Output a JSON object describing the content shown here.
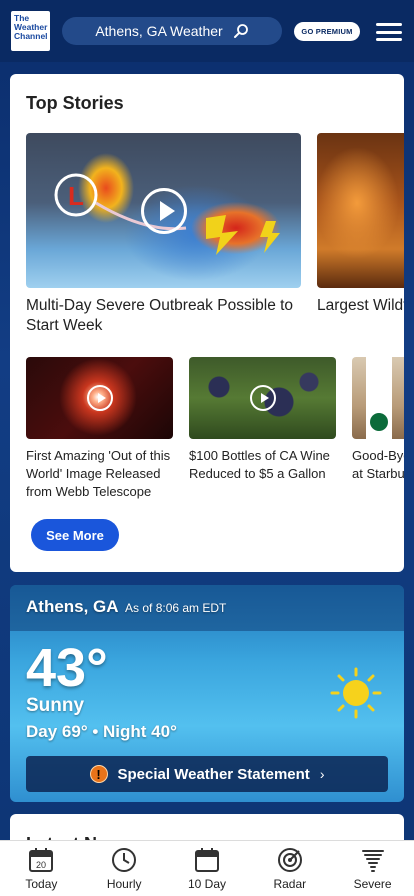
{
  "header": {
    "logo": [
      "The",
      "Weather",
      "Channel"
    ],
    "search_text": "Athens, GA Weather",
    "premium_label": "GO PREMIUM"
  },
  "top_stories": {
    "title": "Top Stories",
    "big": [
      {
        "title": "Multi-Day Severe Outbreak Possible to Start Week",
        "video": true
      },
      {
        "title": "Largest Wildfire Continues to Grow",
        "video": false
      }
    ],
    "small": [
      {
        "title": "First Amazing 'Out of this World' Image Released from Webb Telescope",
        "video": true
      },
      {
        "title": "$100 Bottles of CA Wine Reduced to $5 a Gallon",
        "video": true
      },
      {
        "title": "Good-Bye Plastic Cups at Starbucks",
        "video": false
      }
    ],
    "see_more": "See More"
  },
  "weather": {
    "location": "Athens, GA",
    "as_of": "As of 8:06 am EDT",
    "temperature": "43°",
    "condition": "Sunny",
    "day_night": "Day 69° • Night 40°",
    "alert": "Special Weather Statement",
    "alert_color": "#e8731a"
  },
  "latest_news": {
    "title": "Latest News"
  },
  "bottom_nav": [
    {
      "label": "Today",
      "icon": "calendar-today-icon",
      "day": "20"
    },
    {
      "label": "Hourly",
      "icon": "clock-icon"
    },
    {
      "label": "10 Day",
      "icon": "calendar-icon"
    },
    {
      "label": "Radar",
      "icon": "radar-icon"
    },
    {
      "label": "Severe",
      "icon": "tornado-icon"
    }
  ]
}
